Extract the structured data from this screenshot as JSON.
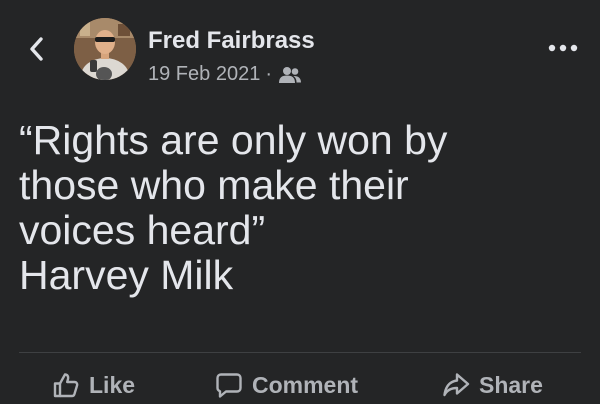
{
  "header": {
    "back_icon": "chevron-left-icon",
    "author_name": "Fred Fairbrass",
    "date": "19 Feb 2021",
    "separator": "·",
    "audience_icon": "friends-icon",
    "more_icon": "more-dots-icon"
  },
  "post": {
    "lines": [
      "“Rights are only won by",
      "those who make their",
      "voices heard”",
      "Harvey Milk"
    ]
  },
  "actions": {
    "like_label": "Like",
    "comment_label": "Comment",
    "share_label": "Share"
  },
  "colors": {
    "background": "#242526",
    "primary_text": "#e4e6eb",
    "secondary_text": "#b0b3b8",
    "divider": "#3e4042"
  }
}
